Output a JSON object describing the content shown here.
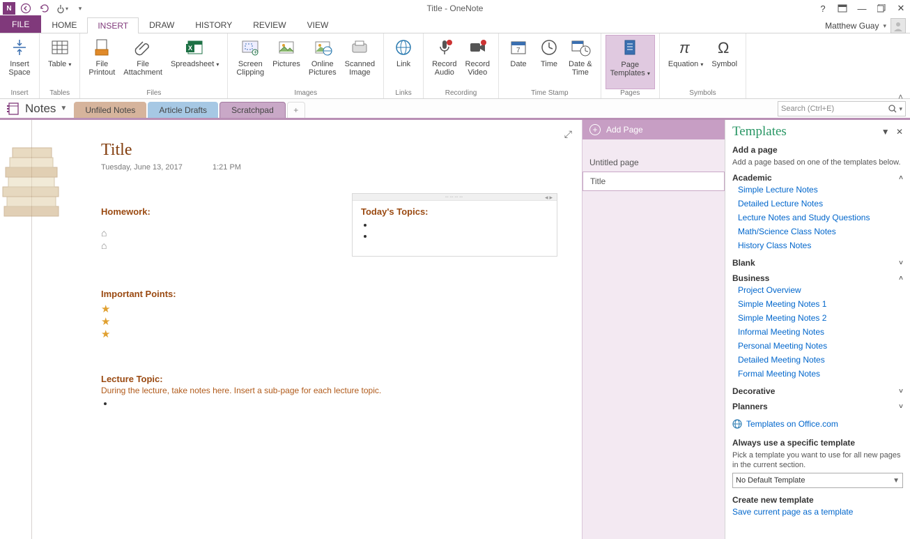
{
  "app": {
    "window_title": "Title - OneNote",
    "user_name": "Matthew Guay"
  },
  "tabs": {
    "file": "FILE",
    "items": [
      "HOME",
      "INSERT",
      "DRAW",
      "HISTORY",
      "REVIEW",
      "VIEW"
    ],
    "active_index": 1
  },
  "ribbon": {
    "groups": [
      {
        "label": "Insert",
        "items": [
          {
            "label": "Insert\nSpace"
          }
        ]
      },
      {
        "label": "Tables",
        "items": [
          {
            "label": "Table"
          }
        ]
      },
      {
        "label": "Files",
        "items": [
          {
            "label": "File\nPrintout"
          },
          {
            "label": "File\nAttachment"
          },
          {
            "label": "Spreadsheet"
          }
        ]
      },
      {
        "label": "Images",
        "items": [
          {
            "label": "Screen\nClipping"
          },
          {
            "label": "Pictures"
          },
          {
            "label": "Online\nPictures"
          },
          {
            "label": "Scanned\nImage"
          }
        ]
      },
      {
        "label": "Links",
        "items": [
          {
            "label": "Link"
          }
        ]
      },
      {
        "label": "Recording",
        "items": [
          {
            "label": "Record\nAudio"
          },
          {
            "label": "Record\nVideo"
          }
        ]
      },
      {
        "label": "Time Stamp",
        "items": [
          {
            "label": "Date"
          },
          {
            "label": "Time"
          },
          {
            "label": "Date &\nTime"
          }
        ]
      },
      {
        "label": "Pages",
        "items": [
          {
            "label": "Page\nTemplates",
            "active": true
          }
        ]
      },
      {
        "label": "Symbols",
        "items": [
          {
            "label": "Equation"
          },
          {
            "label": "Symbol"
          }
        ]
      }
    ]
  },
  "notebook": {
    "name": "Notes",
    "sections": [
      {
        "label": "Unfiled Notes",
        "cls": "unfiled"
      },
      {
        "label": "Article Drafts",
        "cls": "drafts"
      },
      {
        "label": "Scratchpad",
        "cls": "scratch",
        "active": true
      }
    ],
    "search_placeholder": "Search (Ctrl+E)"
  },
  "pagelist": {
    "add_label": "Add Page",
    "pages": [
      {
        "label": "Untitled page",
        "active": false
      },
      {
        "label": "Title",
        "active": true
      }
    ]
  },
  "page": {
    "title": "Title",
    "date": "Tuesday, June 13, 2017",
    "time": "1:21 PM",
    "homework_head": "Homework:",
    "important_head": "Important Points:",
    "lecture_head": "Lecture Topic:",
    "lecture_body": "During the lecture, take notes here.  Insert a sub-page for each lecture topic.",
    "topics_head": "Today's Topics:"
  },
  "templates": {
    "title": "Templates",
    "add_head": "Add a page",
    "add_desc": "Add a page based on one of the templates below.",
    "cats": {
      "academic": {
        "label": "Academic",
        "open": true,
        "items": [
          "Simple Lecture Notes",
          "Detailed Lecture Notes",
          "Lecture Notes and Study Questions",
          "Math/Science Class Notes",
          "History Class Notes"
        ]
      },
      "blank": {
        "label": "Blank",
        "open": false
      },
      "business": {
        "label": "Business",
        "open": true,
        "items": [
          "Project Overview",
          "Simple Meeting Notes 1",
          "Simple Meeting Notes 2",
          "Informal Meeting Notes",
          "Personal Meeting Notes",
          "Detailed Meeting Notes",
          "Formal Meeting Notes"
        ]
      },
      "decorative": {
        "label": "Decorative",
        "open": false
      },
      "planners": {
        "label": "Planners",
        "open": false
      }
    },
    "office_link": "Templates on Office.com",
    "always_head": "Always use a specific template",
    "always_desc": "Pick a template you want to use for all new pages in the current section.",
    "dropdown_value": "No Default Template",
    "create_head": "Create new template",
    "save_link": "Save current page as a template"
  }
}
